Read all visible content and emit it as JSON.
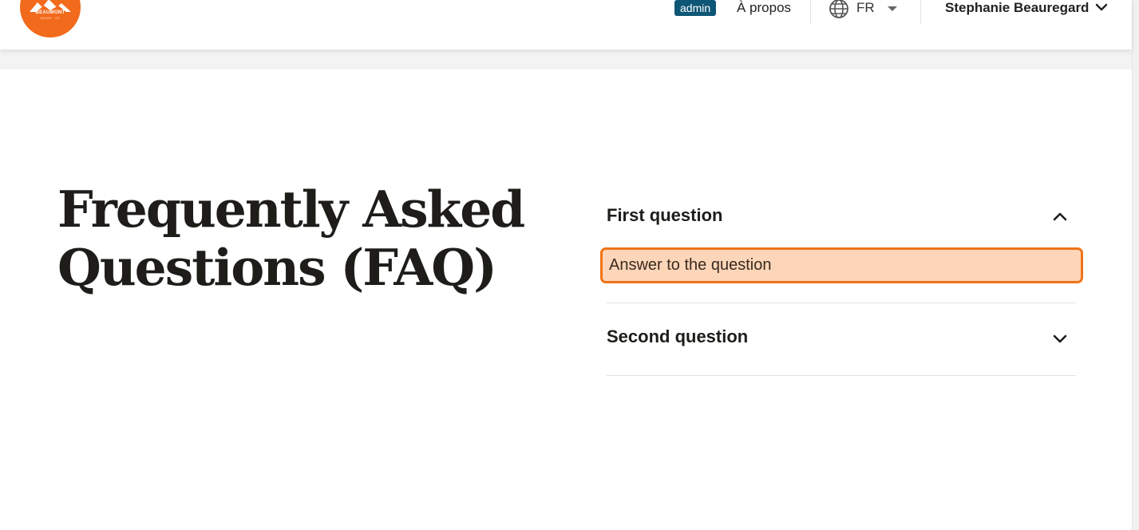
{
  "header": {
    "logo": {
      "name": "BEAUMONT",
      "tagline": "BOUGE · VIT",
      "color": "#f26a1b"
    },
    "admin_badge": "admin",
    "about_link": "À propos",
    "language": {
      "icon": "globe-icon",
      "selected": "FR"
    },
    "user": {
      "name": "Stephanie Beauregard",
      "icon": "chevron-down-icon"
    }
  },
  "main": {
    "title_line1": "Frequently Asked",
    "title_line2": "Questions (FAQ)",
    "faq": [
      {
        "question": "First question",
        "answer": "Answer to the question",
        "expanded": true,
        "icon": "chevron-up-icon"
      },
      {
        "question": "Second question",
        "expanded": false,
        "icon": "chevron-down-icon"
      }
    ]
  },
  "colors": {
    "accent_orange": "#f07417",
    "answer_highlight": "#fdd5b8",
    "admin_badge": "#0e5675",
    "title_text": "#1f1d1a"
  }
}
